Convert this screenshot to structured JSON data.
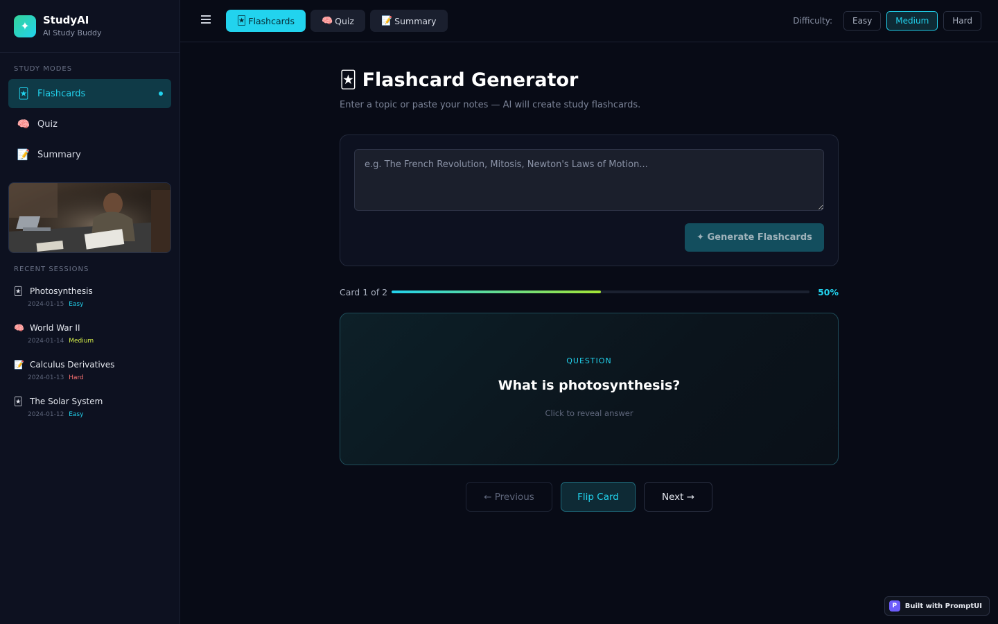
{
  "brand": {
    "name": "StudyAI",
    "tagline": "AI Study Buddy",
    "logo_icon": "sparkle-icon",
    "logo_glyph": "✦"
  },
  "sidebar": {
    "modes_label": "STUDY MODES",
    "modes": [
      {
        "label": "Flashcards",
        "icon": "flashcard-icon",
        "glyph": "🃏",
        "active": true
      },
      {
        "label": "Quiz",
        "icon": "brain-icon",
        "glyph": "🧠",
        "active": false
      },
      {
        "label": "Summary",
        "icon": "memo-icon",
        "glyph": "📝",
        "active": false
      }
    ],
    "recent_label": "RECENT SESSIONS",
    "recent": [
      {
        "title": "Photosynthesis",
        "date": "2024-01-15",
        "level": "Easy",
        "icon": "flashcard-icon",
        "glyph": "🃏"
      },
      {
        "title": "World War II",
        "date": "2024-01-14",
        "level": "Medium",
        "icon": "brain-icon",
        "glyph": "🧠"
      },
      {
        "title": "Calculus Derivatives",
        "date": "2024-01-13",
        "level": "Hard",
        "icon": "memo-icon",
        "glyph": "📝"
      },
      {
        "title": "The Solar System",
        "date": "2024-01-12",
        "level": "Easy",
        "icon": "flashcard-icon",
        "glyph": "🃏"
      }
    ]
  },
  "topbar": {
    "tabs": [
      {
        "label": "Flashcards",
        "glyph": "🃏",
        "active": true
      },
      {
        "label": "Quiz",
        "glyph": "🧠",
        "active": false
      },
      {
        "label": "Summary",
        "glyph": "📝",
        "active": false
      }
    ],
    "difficulty_label": "Difficulty:",
    "difficulty_options": [
      "Easy",
      "Medium",
      "Hard"
    ],
    "difficulty_selected": "Medium"
  },
  "main": {
    "title": "Flashcard Generator",
    "title_glyph": "🃏",
    "subtitle": "Enter a topic or paste your notes — AI will create study flashcards.",
    "input_value": "",
    "input_placeholder": "e.g. The French Revolution, Mitosis, Newton's Laws of Motion...",
    "generate_label": "✦ Generate Flashcards",
    "progress_label": "Card 1 of 2",
    "progress_pct_label": "50%",
    "progress_fraction": 0.5,
    "card_kicker": "QUESTION",
    "card_question": "What is photosynthesis?",
    "card_hint": "Click to reveal answer",
    "prev_label": "← Previous",
    "flip_label": "Flip Card",
    "next_label": "Next →"
  },
  "badge": {
    "label": "Built with PromptUI",
    "logo_letter": "P"
  },
  "colors": {
    "accent": "#22d3ee",
    "easy": "#22d3ee",
    "medium": "#d9f24a",
    "hard": "#f87171",
    "background": "#080b16"
  }
}
